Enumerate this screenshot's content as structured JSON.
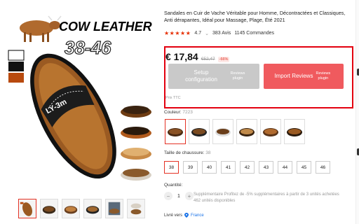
{
  "product": {
    "title": "Sandales en Cuir de Vache Véritable pour Homme, Décontractées et Classiques, Anti dérapantes, Idéal pour Massage, Plage, Été 2021",
    "stars": "★★★★★",
    "rating": "4.7",
    "rating_caret": "⌄",
    "reviews": "383 Avis",
    "orders": "1145 Commandes",
    "image_text_brand": "COW LEATHER",
    "image_text_sizes": "38-46",
    "image_text_sole": "LY-3m"
  },
  "price": {
    "current": "€ 17,84",
    "old": "€52,47",
    "discount": "-66%",
    "tax_note": "Prix TTC"
  },
  "plugin": {
    "setup_label": "Setup configuration",
    "setup_sub": "Reviews plugin",
    "import_label": "Import Reviews",
    "import_sub": "Reviews plugin"
  },
  "color": {
    "label": "Couleur:",
    "value": "7223",
    "swatches": [
      "dark-brown",
      "coffee",
      "white-brown",
      "tan",
      "caramel",
      "brown"
    ]
  },
  "size": {
    "label": "Taille de chaussure:",
    "value": "38",
    "options": [
      "38",
      "39",
      "40",
      "41",
      "42",
      "43",
      "44",
      "45",
      "46"
    ]
  },
  "quantity": {
    "label": "Quantité:",
    "minus": "−",
    "value": "1",
    "plus": "+",
    "info_line1": "Supplémentaire Profitez de -5% supplémentaires à partir de 3 unités achetées",
    "info_line2": "462 unités disponibles"
  },
  "shipping": {
    "label": "Livré vers",
    "country": "France"
  },
  "colors": {
    "accent": "#e43225",
    "frame": "#e3000f",
    "setup_button": "#c9c9c9",
    "import_button": "#f05a5e",
    "leather": "#9a5a22"
  },
  "icons": {
    "location": "pin-icon",
    "star": "star-icon"
  }
}
